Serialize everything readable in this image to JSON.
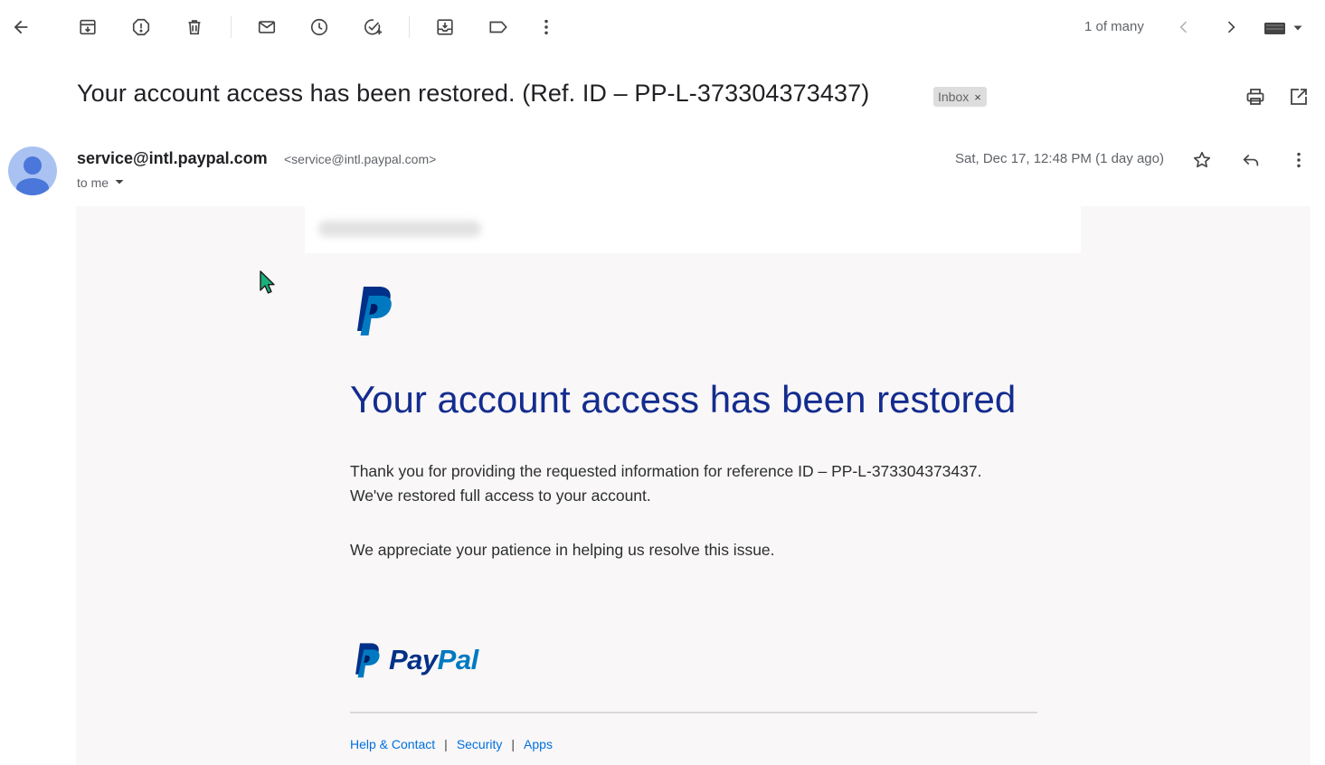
{
  "toolbar": {
    "pager_text": "1 of many"
  },
  "message": {
    "subject": "Your account access has been restored. (Ref. ID – PP-L-373304373437)",
    "label": "Inbox",
    "label_remove": "×",
    "sender_name": "service@intl.paypal.com",
    "sender_email": "<service@intl.paypal.com>",
    "recipient": "to me",
    "date": "Sat, Dec 17, 12:48 PM (1 day ago)"
  },
  "email": {
    "headline": "Your account access has been restored",
    "paragraph1_line1": "Thank you for providing the requested information for reference ID – PP-L-373304373437.",
    "paragraph1_line2": "We've restored full access to your account.",
    "paragraph2": "We appreciate your patience in helping us resolve this issue.",
    "brand_pay": "Pay",
    "brand_pal": "Pal",
    "footer_links": [
      "Help & Contact",
      "Security",
      "Apps"
    ],
    "footer_separator": "|"
  },
  "colors": {
    "headline": "#142c8e",
    "paypal_dark": "#003087",
    "paypal_light": "#0079c1",
    "link": "#0070e0",
    "body_bg": "#f9f7f7"
  }
}
